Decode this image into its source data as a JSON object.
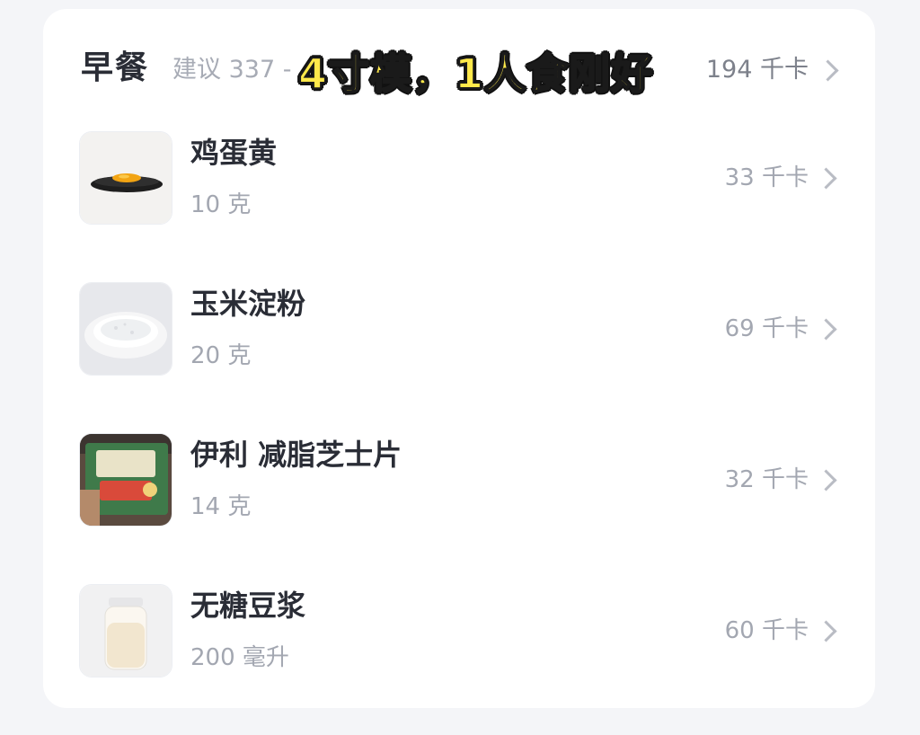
{
  "meal": {
    "title": "早餐",
    "suggest": "建议 337 -",
    "total_kcal": "194 千卡"
  },
  "overlay": {
    "caption": "4寸模，1人食刚好"
  },
  "foods": [
    {
      "name": "鸡蛋黄",
      "amount": "10 克",
      "kcal": "33 千卡",
      "thumb_icon": "egg-yolk-plate-photo"
    },
    {
      "name": "玉米淀粉",
      "amount": "20 克",
      "kcal": "69 千卡",
      "thumb_icon": "cornstarch-plate-photo"
    },
    {
      "name": "伊利 减脂芝士片",
      "amount": "14 克",
      "kcal": "32 千卡",
      "thumb_icon": "cheese-package-photo"
    },
    {
      "name": "无糖豆浆",
      "amount": "200 毫升",
      "kcal": "60 千卡",
      "thumb_icon": "soy-milk-bottle-photo"
    }
  ],
  "colors": {
    "background": "#f4f5f8",
    "card": "#ffffff",
    "title_text": "#2a2d36",
    "secondary_text": "#a3a7b1",
    "caption_fill": "#ffe94a"
  }
}
